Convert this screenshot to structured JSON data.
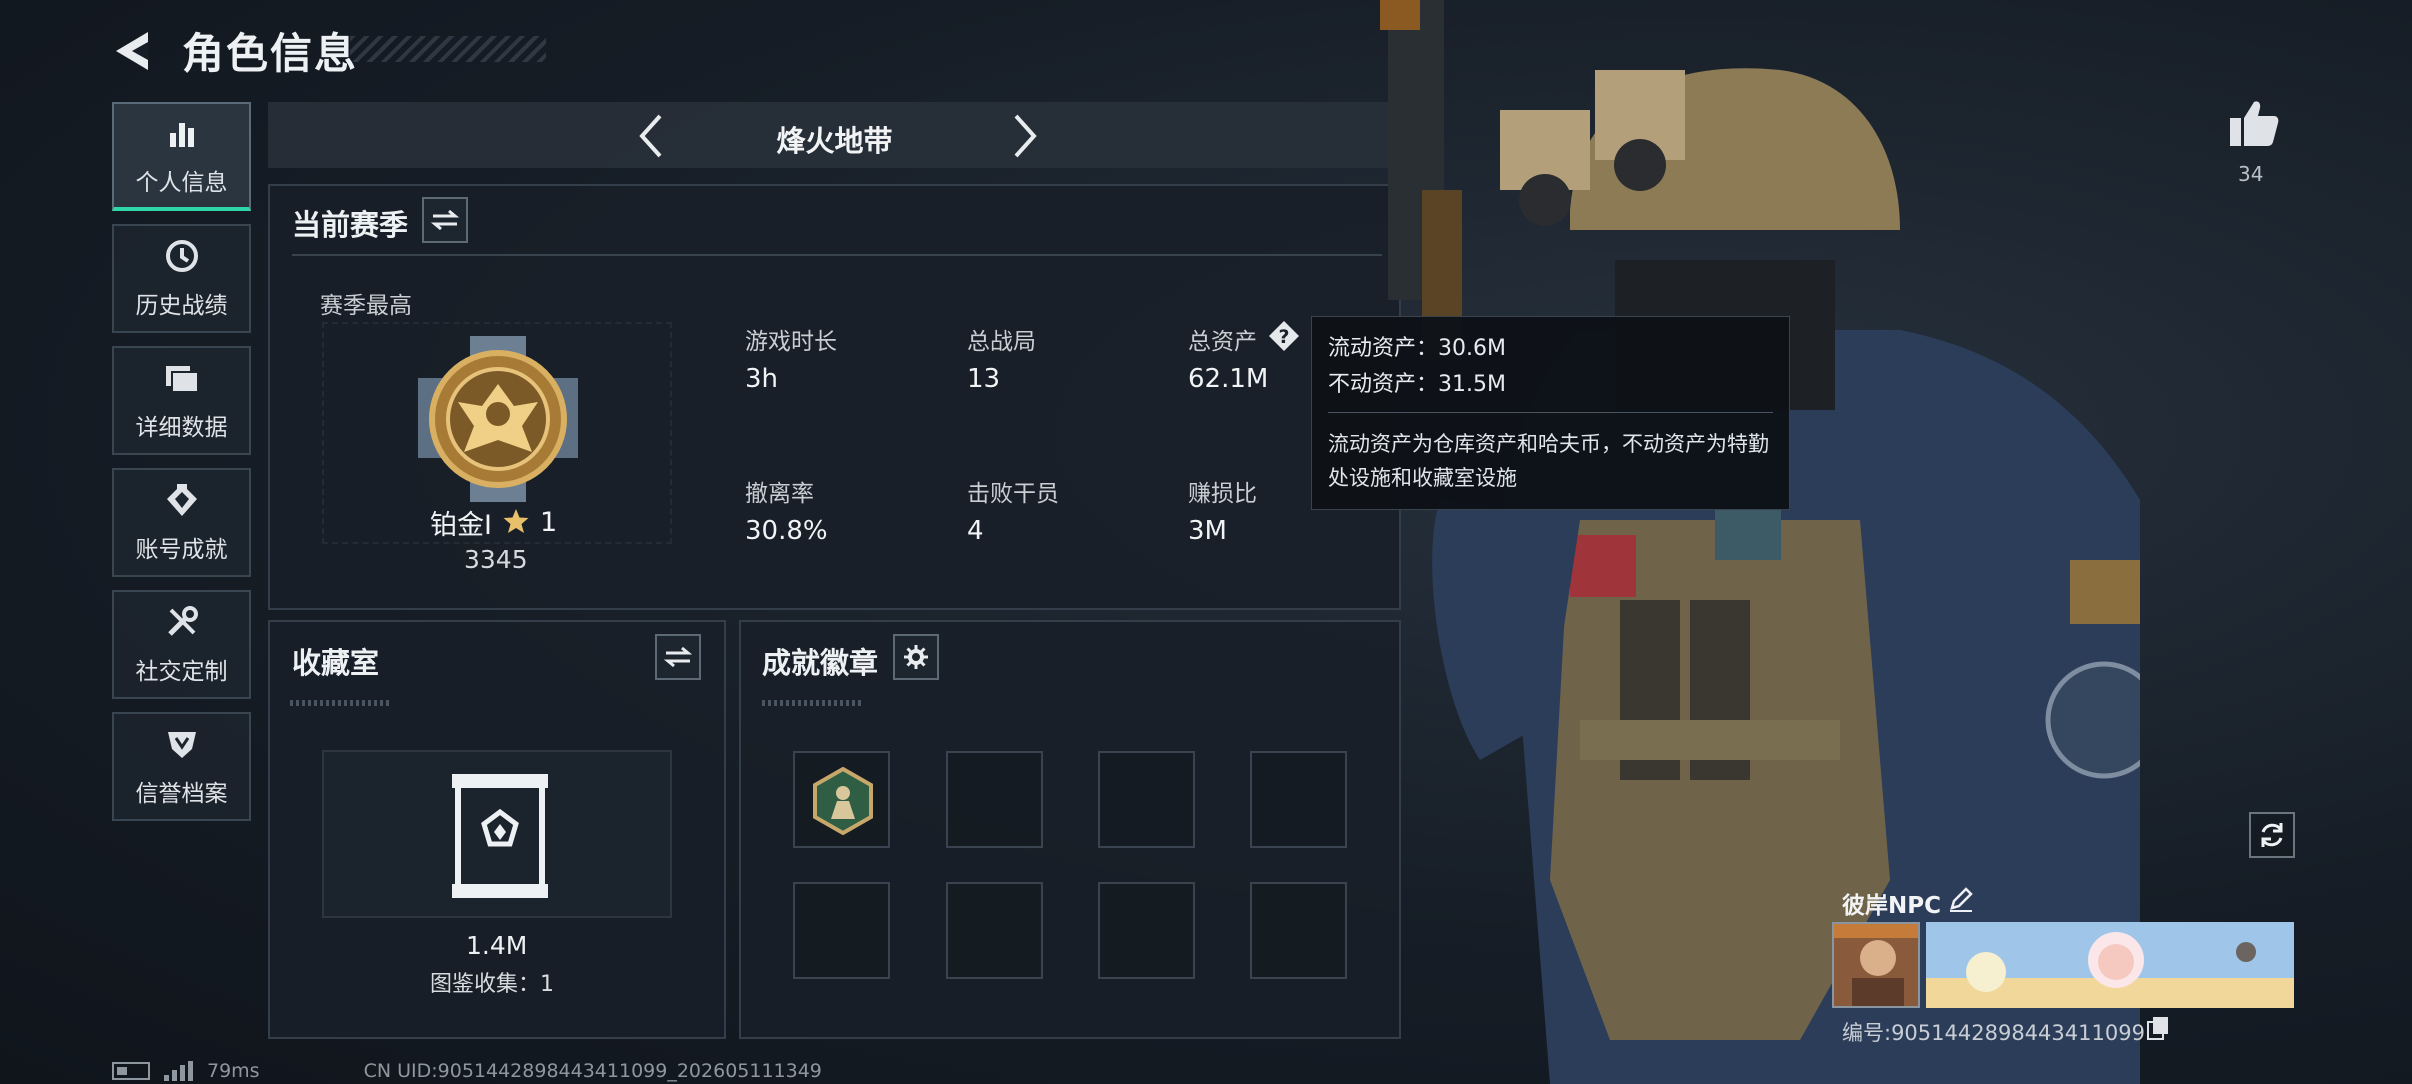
{
  "header": {
    "title": "角色信息"
  },
  "sidebar": {
    "items": [
      {
        "label": "个人信息",
        "icon": "bar-chart-icon",
        "active": true
      },
      {
        "label": "历史战绩",
        "icon": "history-icon",
        "active": false
      },
      {
        "label": "详细数据",
        "icon": "folder-icon",
        "active": false
      },
      {
        "label": "账号成就",
        "icon": "achievement-icon",
        "active": false
      },
      {
        "label": "社交定制",
        "icon": "tools-icon",
        "active": false
      },
      {
        "label": "信誉档案",
        "icon": "reputation-icon",
        "active": false
      }
    ]
  },
  "season_nav": {
    "name": "烽火地带"
  },
  "season": {
    "title": "当前赛季",
    "best_label": "赛季最高",
    "rank_name": "铂金I",
    "rank_stars": "1",
    "rank_points": "3345",
    "stats": [
      {
        "label": "游戏时长",
        "value": "3h"
      },
      {
        "label": "总战局",
        "value": "13"
      },
      {
        "label": "总资产",
        "value": "62.1M"
      },
      {
        "label": "撤离率",
        "value": "30.8%"
      },
      {
        "label": "击败干员",
        "value": "4"
      },
      {
        "label": "赚损比",
        "value": "3M"
      }
    ]
  },
  "tooltip": {
    "liquid": "流动资产：30.6M",
    "fixed": "不动资产：31.5M",
    "desc": "流动资产为仓库资产和哈夫币，不动资产为特勤处设施和收藏室设施"
  },
  "collection": {
    "title": "收藏室",
    "value": "1.4M",
    "catalog": "图鉴收集：1"
  },
  "badges": {
    "title": "成就徽章"
  },
  "social": {
    "likes": "34"
  },
  "player": {
    "name": "彼岸NPC",
    "id": "编号:9051442898443411099"
  },
  "status_bar": {
    "ping": "79ms",
    "uid": "CN UID:9051442898443411099_202605111349"
  },
  "colors": {
    "accent": "#2fd7a8",
    "panel_bg": "#181f28",
    "border": "#343e4a"
  }
}
